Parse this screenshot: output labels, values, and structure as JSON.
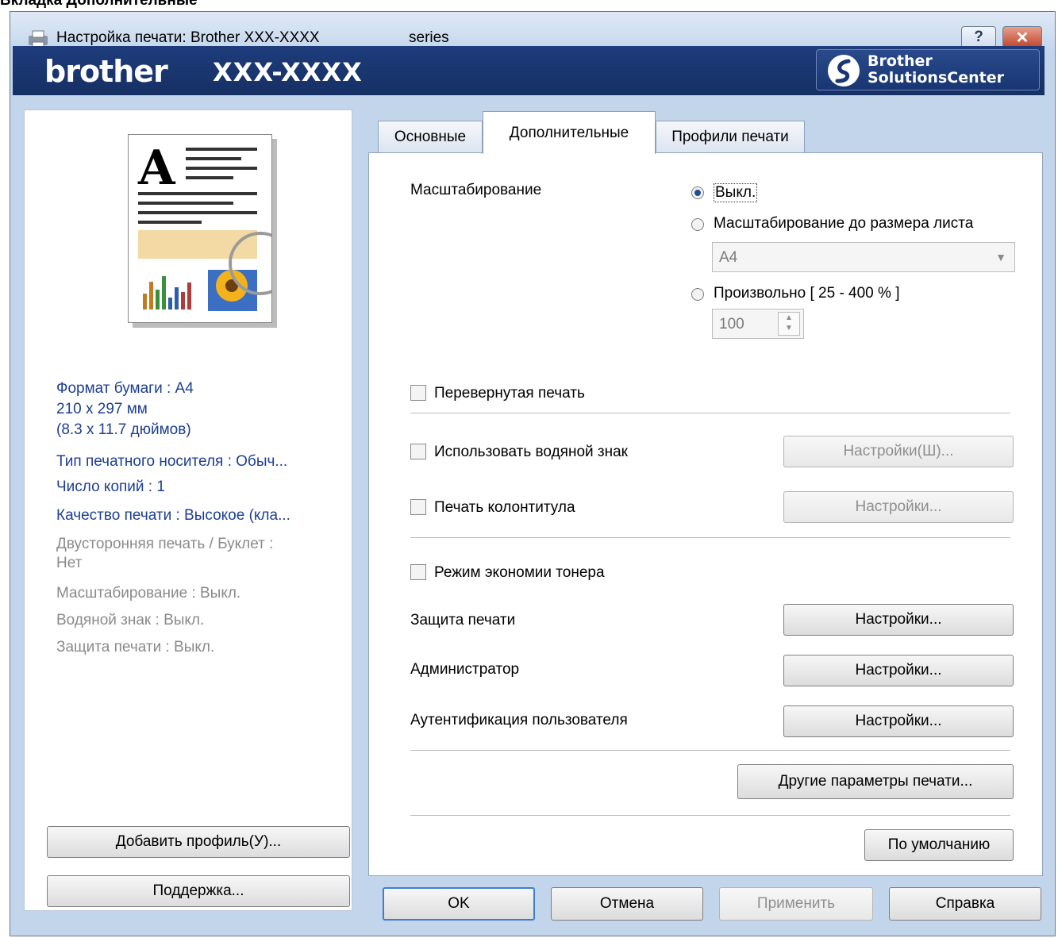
{
  "doc_heading": "Вкладка Дополнительные",
  "window": {
    "title": "Настройка печати: Brother XXX-XXXX",
    "title_series": "series",
    "help_label": "?",
    "close_label": "✕"
  },
  "banner": {
    "brand": "brother",
    "model": "XXX-XXXX",
    "solutions_line1": "Brother",
    "solutions_line2": "SolutionsCenter"
  },
  "summary": {
    "paper_format": "Формат бумаги : А4",
    "paper_size_mm": "210 x 297 мм",
    "paper_size_in": "(8.3 x 11.7 дюймов)",
    "media_type": "Тип печатного носителя : Обыч...",
    "copies": "Число копий : 1",
    "quality": "Качество печати : Высокое (кла...",
    "duplex_line1": "Двусторонняя печать / Буклет :",
    "duplex_line2": "Нет",
    "scaling": "Масштабирование : Выкл.",
    "watermark": "Водяной знак : Выкл.",
    "protection": "Защита печати : Выкл."
  },
  "left_buttons": {
    "add_profile": "Добавить профиль(У)...",
    "support": "Поддержка..."
  },
  "tabs": [
    "Основные",
    "Дополнительные",
    "Профили печати"
  ],
  "panel": {
    "scaling_label": "Масштабирование",
    "opt_off": "Выкл.",
    "opt_fit": "Масштабирование до размера листа",
    "paper_select": "A4",
    "opt_custom": "Произвольно [ 25 - 400 % ]",
    "custom_value": "100",
    "mirror": "Перевернутая печать",
    "watermark": "Использовать водяной знак",
    "watermark_btn": "Настройки(Ш)...",
    "header_footer": "Печать колонтитула",
    "header_footer_btn": "Настройки...",
    "toner_save": "Режим экономии тонера",
    "secure_print": "Защита печати",
    "secure_print_btn": "Настройки...",
    "administrator": "Администратор",
    "administrator_btn": "Настройки...",
    "user_auth": "Аутентификация пользователя",
    "user_auth_btn": "Настройки...",
    "other_options_btn": "Другие параметры печати...",
    "default_btn": "По умолчанию"
  },
  "footer": {
    "ok": "OK",
    "cancel": "Отмена",
    "apply": "Применить",
    "help": "Справка"
  },
  "colors": {
    "banner": "#1e3c7c",
    "info_text": "#1c3e94",
    "disabled_text": "#8a8a8a"
  }
}
